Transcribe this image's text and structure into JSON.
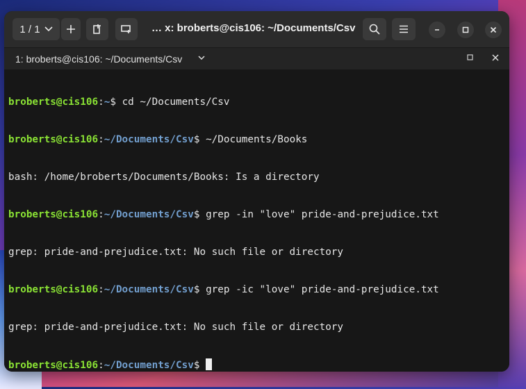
{
  "window": {
    "title": "… x: broberts@cis106: ~/Documents/Csv",
    "tab_counter": "1 / 1",
    "tab_label": "1: broberts@cis106: ~/Documents/Csv"
  },
  "prompt": {
    "user_host": "broberts@cis106",
    "colon": ":",
    "dollar": "$ "
  },
  "lines": [
    {
      "type": "prompt",
      "path": "~",
      "cmd": "cd ~/Documents/Csv"
    },
    {
      "type": "prompt",
      "path": "~/Documents/Csv",
      "cmd": "~/Documents/Books"
    },
    {
      "type": "output",
      "text": "bash: /home/broberts/Documents/Books: Is a directory"
    },
    {
      "type": "prompt",
      "path": "~/Documents/Csv",
      "cmd": "grep -in \"love\" pride-and-prejudice.txt"
    },
    {
      "type": "output",
      "text": "grep: pride-and-prejudice.txt: No such file or directory"
    },
    {
      "type": "prompt",
      "path": "~/Documents/Csv",
      "cmd": "grep -ic \"love\" pride-and-prejudice.txt"
    },
    {
      "type": "output",
      "text": "grep: pride-and-prejudice.txt: No such file or directory"
    },
    {
      "type": "prompt",
      "path": "~/Documents/Csv",
      "cmd": ""
    }
  ],
  "icons": {
    "chevron": "chevron-down-icon",
    "plus": "plus-icon",
    "detach": "detach-tab-icon",
    "new_window": "new-window-icon",
    "search": "search-icon",
    "menu": "hamburger-menu-icon",
    "minimize": "minimize-icon",
    "maximize": "maximize-icon",
    "close": "close-icon"
  },
  "colors": {
    "user": "#8ae234",
    "path": "#729fcf",
    "background": "#171717"
  }
}
